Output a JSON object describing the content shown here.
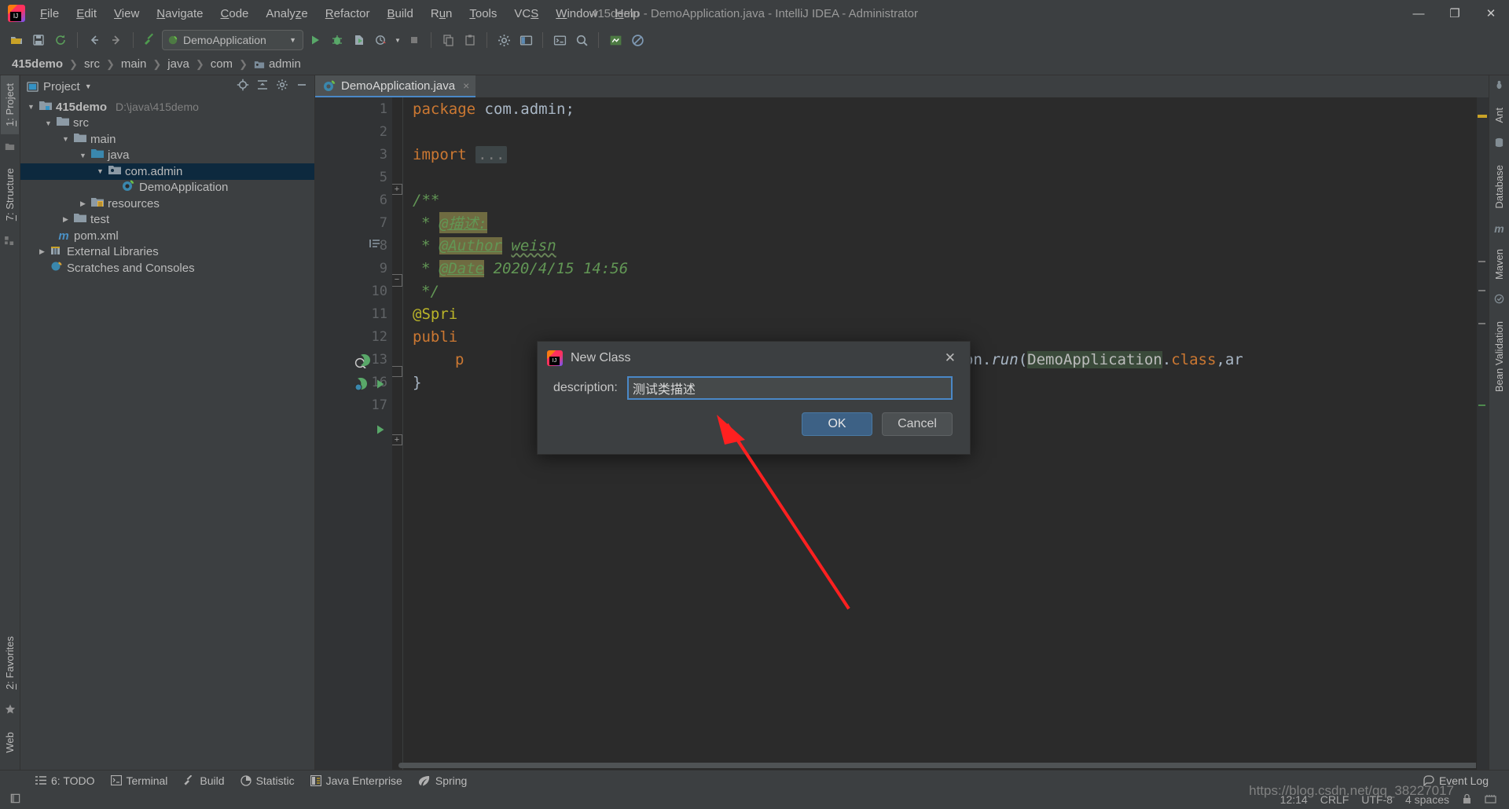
{
  "window": {
    "title": "415demo - DemoApplication.java - IntelliJ IDEA - Administrator",
    "minimize": "—",
    "maximize": "❐",
    "close": "✕"
  },
  "menubar": [
    {
      "label": "File"
    },
    {
      "label": "Edit"
    },
    {
      "label": "View"
    },
    {
      "label": "Navigate"
    },
    {
      "label": "Code"
    },
    {
      "label": "Analyze"
    },
    {
      "label": "Refactor"
    },
    {
      "label": "Build"
    },
    {
      "label": "Run"
    },
    {
      "label": "Tools"
    },
    {
      "label": "VCS"
    },
    {
      "label": "Window"
    },
    {
      "label": "Help"
    }
  ],
  "toolbar": {
    "run_config": "DemoApplication",
    "icons": [
      "open-folder-icon",
      "save-all-icon",
      "sync-icon",
      "back-arrow-icon",
      "forward-arrow-icon",
      "build-hammer-icon",
      "run-icon",
      "debug-icon",
      "run-coverage-icon",
      "profiler-icon",
      "stop-icon",
      "copy-icon",
      "paste-icon",
      "settings-icon",
      "project-structure-icon",
      "terminal-icon",
      "search-everywhere-icon",
      "updates-icon",
      "no-entry-icon"
    ]
  },
  "breadcrumb": [
    "415demo",
    "src",
    "main",
    "java",
    "com",
    "admin"
  ],
  "left_strip": {
    "project_tab": "1: Project",
    "structure_tab": "7: Structure",
    "favorites_tab": "2: Favorites",
    "web_tab": "Web"
  },
  "right_strip": {
    "ant_tab": "Ant",
    "database_tab": "Database",
    "maven_tab": "Maven",
    "bean_validation_tab": "Bean Validation"
  },
  "project_panel": {
    "title": "Project",
    "tree": [
      {
        "label": "415demo",
        "path": "D:\\java\\415demo",
        "depth": 0,
        "arrow": "▼",
        "icon": "module-icon",
        "bold": true,
        "selected": false
      },
      {
        "label": "src",
        "path": "",
        "depth": 1,
        "arrow": "▼",
        "icon": "folder-icon",
        "bold": false,
        "selected": false
      },
      {
        "label": "main",
        "path": "",
        "depth": 2,
        "arrow": "▼",
        "icon": "folder-icon",
        "bold": false,
        "selected": false
      },
      {
        "label": "java",
        "path": "",
        "depth": 3,
        "arrow": "▼",
        "icon": "source-folder-icon",
        "bold": false,
        "selected": false
      },
      {
        "label": "com.admin",
        "path": "",
        "depth": 4,
        "arrow": "▼",
        "icon": "package-icon",
        "bold": false,
        "selected": true
      },
      {
        "label": "DemoApplication",
        "path": "",
        "depth": 5,
        "arrow": "",
        "icon": "spring-class-icon",
        "bold": false,
        "selected": false
      },
      {
        "label": "resources",
        "path": "",
        "depth": 3,
        "arrow": "▶",
        "icon": "resource-folder-icon",
        "bold": false,
        "selected": false
      },
      {
        "label": "test",
        "path": "",
        "depth": 2,
        "arrow": "▶",
        "icon": "folder-icon",
        "bold": false,
        "selected": false
      },
      {
        "label": "pom.xml",
        "path": "",
        "depth": 1,
        "arrow": "",
        "icon": "maven-icon",
        "bold": false,
        "selected": false
      },
      {
        "label": "External Libraries",
        "path": "",
        "depth": 0,
        "arrow": "▶",
        "icon": "library-icon",
        "bold": false,
        "selected": false
      },
      {
        "label": "Scratches and Consoles",
        "path": "",
        "depth": 0,
        "arrow": "",
        "icon": "scratches-icon",
        "bold": false,
        "selected": false
      }
    ]
  },
  "editor": {
    "tab_label": "DemoApplication.java",
    "tab_close": "×",
    "line_numbers": [
      "1",
      "2",
      "3",
      "5",
      "6",
      "7",
      "8",
      "9",
      "10",
      "11",
      "12",
      "13",
      "16",
      "17"
    ],
    "lines": [
      {
        "n": "1",
        "text": "package com.admin;"
      },
      {
        "n": "2",
        "text": ""
      },
      {
        "n": "3",
        "text": "import ..."
      },
      {
        "n": "5",
        "text": ""
      },
      {
        "n": "6",
        "text": "/**"
      },
      {
        "n": "7",
        "text": " * @描述:"
      },
      {
        "n": "8",
        "text": " * @Author weisn"
      },
      {
        "n": "9",
        "text": " * @Date 2020/4/15 14:56"
      },
      {
        "n": "10",
        "text": " */"
      },
      {
        "n": "11",
        "text": "@SpringBootApplication"
      },
      {
        "n": "12",
        "text": "public class DemoApplication {"
      },
      {
        "n": "13",
        "text": "    public static void main(String[] args) { SpringApplication.run(DemoApplication.class,args);"
      },
      {
        "n": "16",
        "text": "}"
      },
      {
        "n": "17",
        "text": ""
      }
    ],
    "tokens": {
      "package_kw": "package",
      "package_name": "com.admin;",
      "import_kw": "import",
      "import_folded": "...",
      "doc_open": "/**",
      "doc_star": "*",
      "tag_desc": "@描述:",
      "tag_author": "@Author",
      "author_value": "weisn",
      "tag_date": "@Date",
      "date_value": "2020/4/15 14:56",
      "doc_close": "*/",
      "annotation": "@Spri",
      "public_kw": "publi",
      "run_prefix": "p",
      "run_call": "SpringApplication.",
      "run_method": "run",
      "run_open": "(",
      "run_class": "DemoApplication",
      "run_dot": ".",
      "run_classkw": "class",
      "run_args": ",ar",
      "brace_close": "}"
    }
  },
  "dialog": {
    "title": "New Class",
    "close_glyph": "✕",
    "field_label": "description:",
    "field_value": "测试类描述",
    "ok_label": "OK",
    "cancel_label": "Cancel",
    "ok_color": "#3d6185"
  },
  "bottom_tool_window_bar": [
    {
      "label": "6: TODO",
      "icon": "todo-icon",
      "mnemonic": "6"
    },
    {
      "label": "Terminal",
      "icon": "terminal-icon",
      "mnemonic": ""
    },
    {
      "label": "Build",
      "icon": "build-hammer-icon",
      "mnemonic": ""
    },
    {
      "label": "Statistic",
      "icon": "statistic-pie-icon",
      "mnemonic": ""
    },
    {
      "label": "Java Enterprise",
      "icon": "java-enterprise-icon",
      "mnemonic": ""
    },
    {
      "label": "Spring",
      "icon": "spring-leaf-icon",
      "mnemonic": ""
    }
  ],
  "status_bar": {
    "event_log": "Event Log",
    "time": "12:14",
    "line_separator": "CRLF",
    "encoding": "UTF-8",
    "indent": "4 spaces",
    "watermark": "https://blog.csdn.net/qq_38227017"
  }
}
